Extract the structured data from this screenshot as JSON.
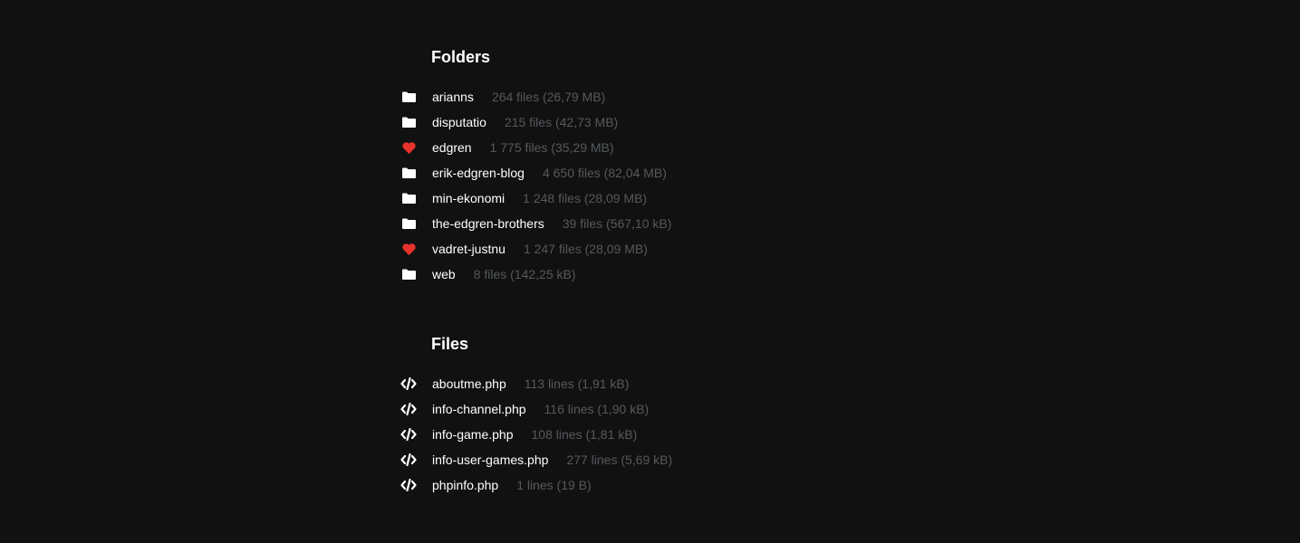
{
  "folders": {
    "title": "Folders",
    "items": [
      {
        "name": "arianns",
        "meta": "264 files (26,79 MB)",
        "icon": "folder-icon"
      },
      {
        "name": "disputatio",
        "meta": "215 files (42,73 MB)",
        "icon": "folder-icon"
      },
      {
        "name": "edgren",
        "meta": "1 775 files (35,29 MB)",
        "icon": "heart-icon"
      },
      {
        "name": "erik-edgren-blog",
        "meta": "4 650 files (82,04 MB)",
        "icon": "folder-icon"
      },
      {
        "name": "min-ekonomi",
        "meta": "1 248 files (28,09 MB)",
        "icon": "folder-icon"
      },
      {
        "name": "the-edgren-brothers",
        "meta": "39 files (567,10 kB)",
        "icon": "folder-icon"
      },
      {
        "name": "vadret-justnu",
        "meta": "1 247 files (28,09 MB)",
        "icon": "heart-icon"
      },
      {
        "name": "web",
        "meta": "8 files (142,25 kB)",
        "icon": "folder-icon"
      }
    ]
  },
  "files": {
    "title": "Files",
    "items": [
      {
        "name": "aboutme.php",
        "meta": "113 lines (1,91 kB)",
        "icon": "code-icon"
      },
      {
        "name": "info-channel.php",
        "meta": "116 lines (1,90 kB)",
        "icon": "code-icon"
      },
      {
        "name": "info-game.php",
        "meta": "108 lines (1,81 kB)",
        "icon": "code-icon"
      },
      {
        "name": "info-user-games.php",
        "meta": "277 lines (5,69 kB)",
        "icon": "code-icon"
      },
      {
        "name": "phpinfo.php",
        "meta": "1 lines (19 B)",
        "icon": "code-icon"
      }
    ]
  },
  "colors": {
    "background": "#111111",
    "text": "#ffffff",
    "meta": "#55595d",
    "heart": "#e8322c"
  }
}
